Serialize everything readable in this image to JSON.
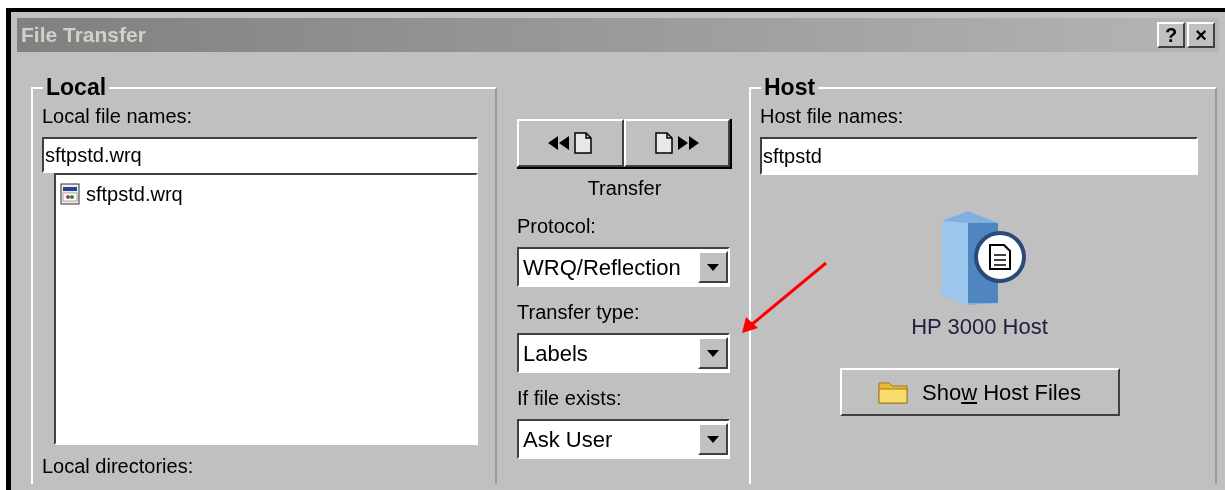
{
  "window": {
    "title": "File Transfer",
    "title_buttons": [
      "?",
      "×"
    ]
  },
  "local": {
    "title": "Local",
    "file_names_label": "Local file names:",
    "file_name_value": "sftpstd.wrq",
    "files": [
      {
        "name": "sftpstd.wrq",
        "selected": false
      }
    ],
    "directories_label": "Local directories:"
  },
  "transfer": {
    "buttons": [
      {
        "kind": "receive"
      },
      {
        "kind": "send"
      }
    ],
    "label": "Transfer",
    "fields": [
      {
        "label": "Protocol:",
        "value": "WRQ/Reflection"
      },
      {
        "label": "Transfer type:",
        "value": "Labels"
      },
      {
        "label": "If file exists:",
        "value": "Ask User"
      }
    ]
  },
  "host": {
    "title": "Host",
    "file_names_label": "Host file names:",
    "file_name_value": "sftpstd",
    "host_name": "HP 3000 Host",
    "show_files_button": {
      "label_parts": [
        {
          "text": "Sho",
          "underlined": false
        },
        {
          "text": "w",
          "underlined": true
        },
        {
          "text": " Host Files",
          "underlined": false
        }
      ]
    }
  }
}
